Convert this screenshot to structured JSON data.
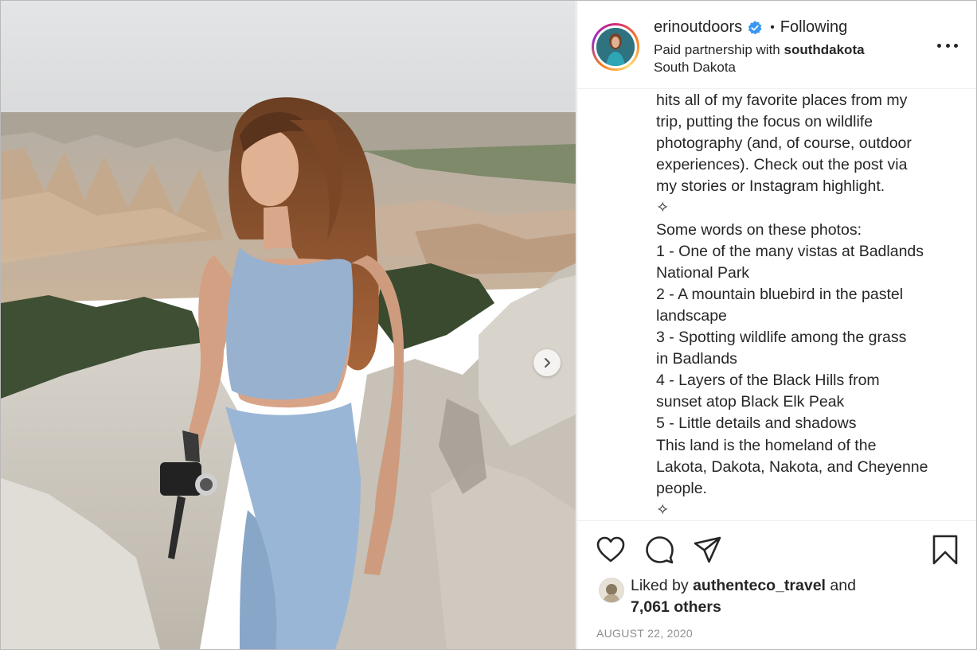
{
  "header": {
    "username": "erinoutdoors",
    "separator": "•",
    "follow_status": "Following",
    "partnership_prefix": "Paid partnership with",
    "partner": "southdakota",
    "location": "South Dakota"
  },
  "caption": {
    "lines": [
      "hits all of my favorite places from my",
      "trip, putting the focus on wildlife",
      "photography (and, of course, outdoor",
      "experiences). Check out the post via",
      "my stories or Instagram highlight.",
      "✧",
      "Some words on these photos:",
      "1 - One of the many vistas at Badlands",
      "National Park",
      "2 - A mountain bluebird in the pastel",
      "landscape",
      "3 - Spotting wildlife among the grass",
      "in Badlands",
      "4 - Layers of the Black Hills from",
      "sunset atop Black Elk Peak",
      "5 - Little details and shadows",
      "This land is the homeland of the",
      "Lakota, Dakota, Nakota, and Cheyenne",
      "people.",
      "✧"
    ]
  },
  "likes": {
    "prefix": "Liked by",
    "user": "authenteco_travel",
    "conjunction": "and",
    "others": "7,061 others"
  },
  "date": "AUGUST 22, 2020",
  "icons": {
    "like": "heart-icon",
    "comment": "comment-icon",
    "share": "share-icon",
    "save": "bookmark-icon",
    "next": "chevron-right-icon",
    "more": "more-options-icon",
    "verified": "verified-badge-icon"
  },
  "colors": {
    "verified_blue": "#3897f0",
    "text": "#262626",
    "muted": "#8e8e8e"
  }
}
